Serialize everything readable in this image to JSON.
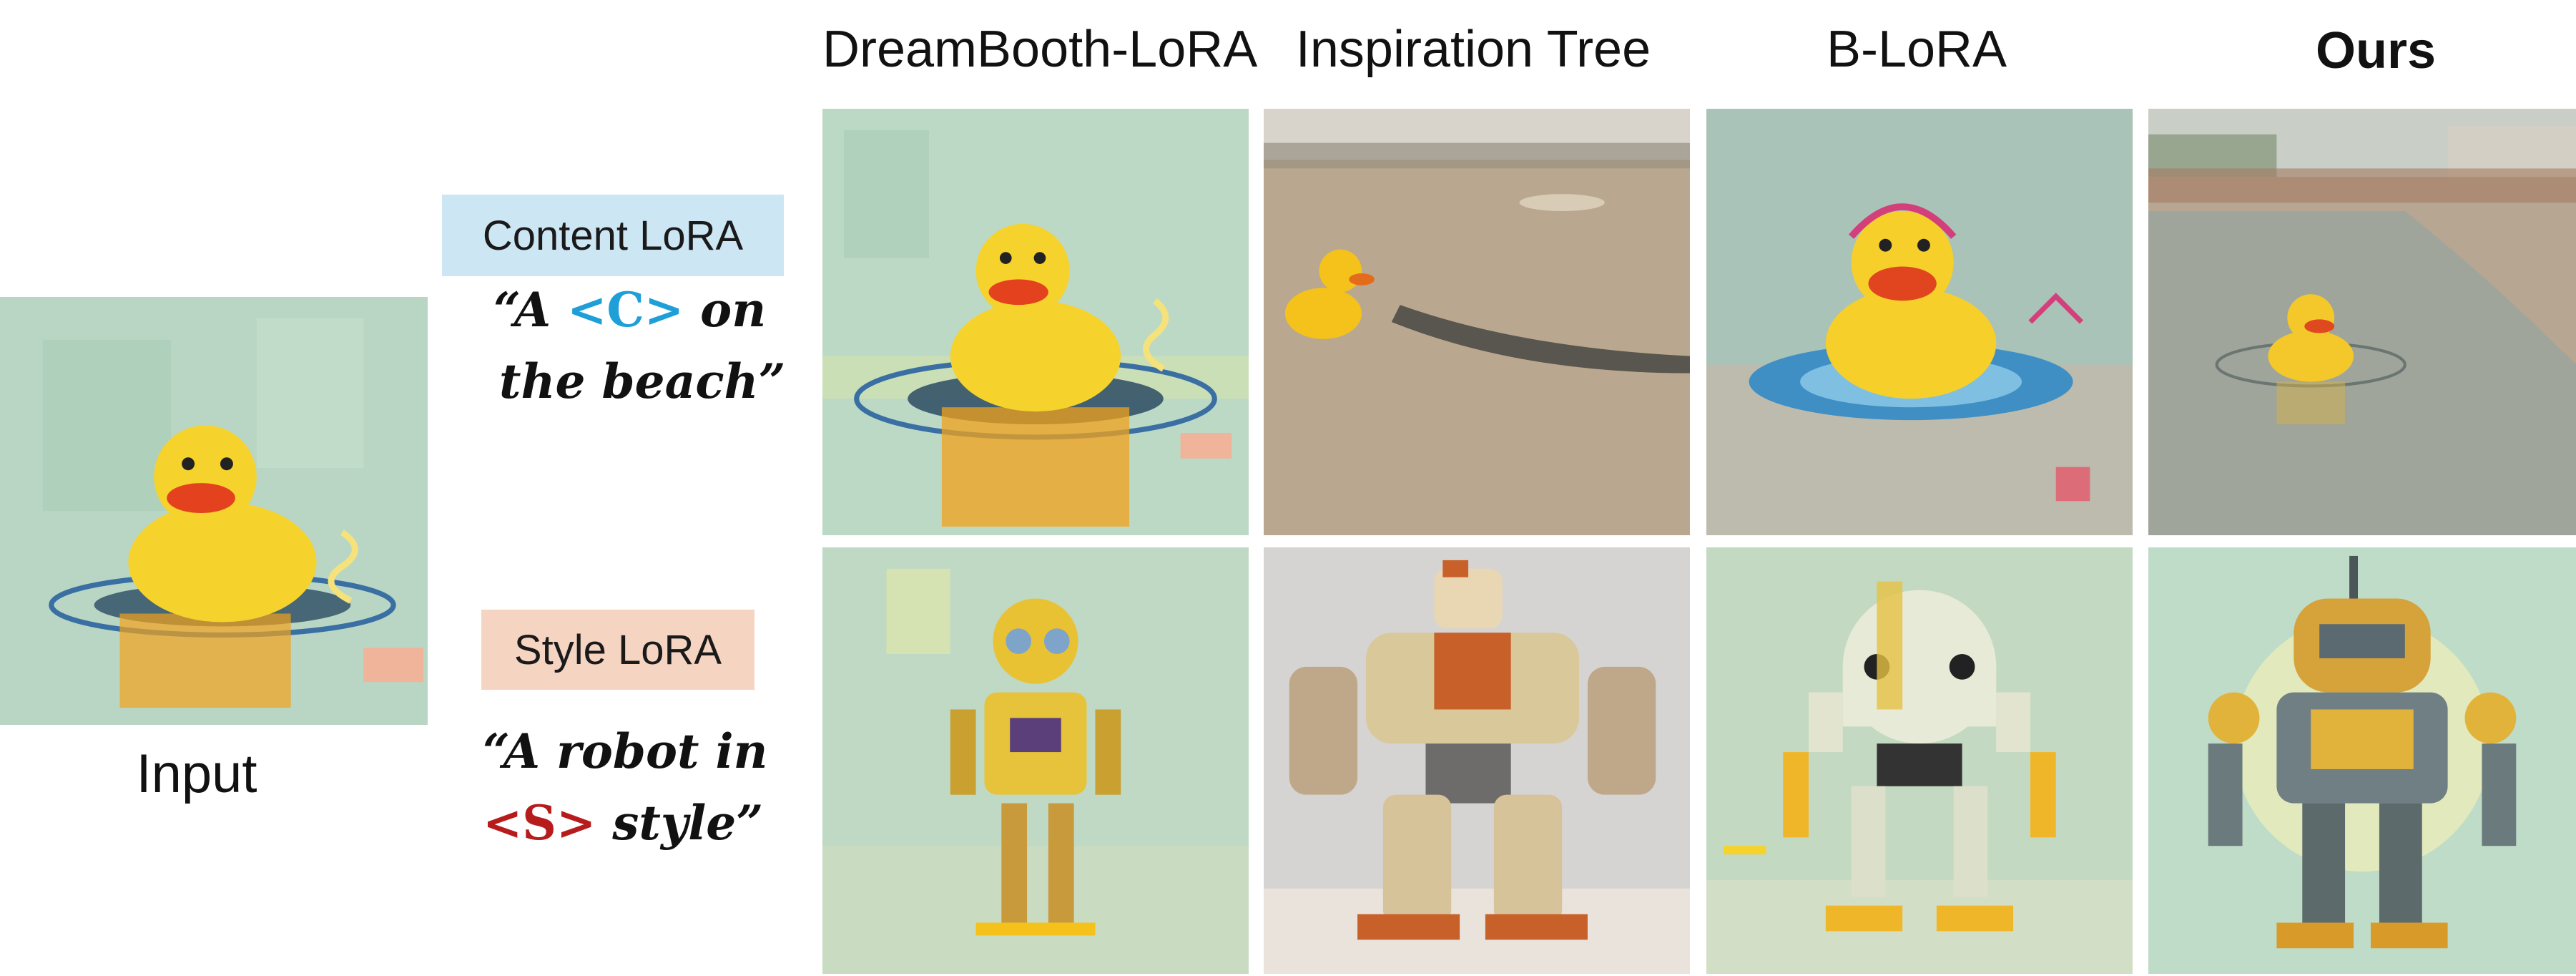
{
  "columns": [
    "DreamBooth-LoRA",
    "Inspiration Tree",
    "B-LoRA",
    "Ours"
  ],
  "input_label": "Input",
  "content_lora": {
    "label": "Content LoRA",
    "box_color": "#cce6f4",
    "prompt_open": "“A ",
    "token": "<C>",
    "prompt_after": " on",
    "prompt_line2": "the beach”",
    "token_color": "#1e9fd8"
  },
  "style_lora": {
    "label": "Style LoRA",
    "box_color": "#f6d4c2",
    "prompt_line1": "“A robot in",
    "token": "<S>",
    "prompt_after": " style”",
    "token_color": "#b71c1c"
  },
  "tiles": {
    "input": "input-duck-painting",
    "row1": [
      "duck-in-water-painting",
      "duck-on-sand-photo",
      "duck-with-headphones-painting",
      "duck-at-beach-painting"
    ],
    "row2": [
      "robot-painting-style",
      "mech-robot-render",
      "round-robot-painting",
      "robot-painting-ours"
    ]
  }
}
